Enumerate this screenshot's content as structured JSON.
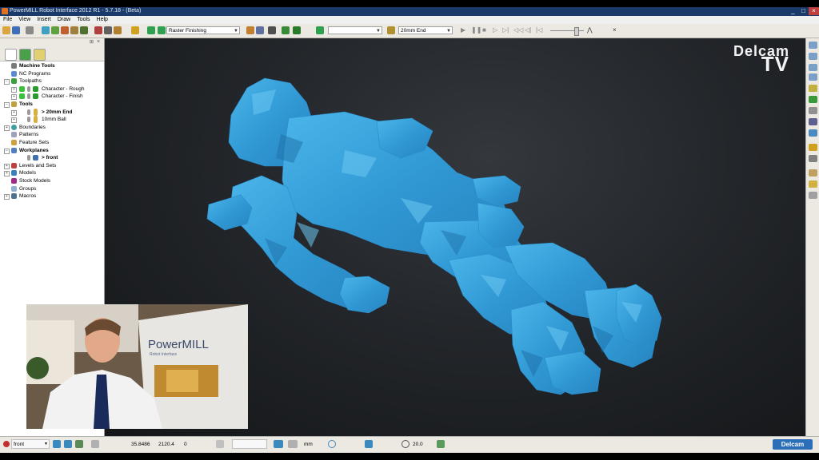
{
  "window": {
    "title": "PowerMILL Robot Interface 2012 R1 - 5.7.18 - (Beta)",
    "minimize": "_",
    "maximize": "□",
    "close": "×"
  },
  "menu": [
    "File",
    "View",
    "Insert",
    "Draw",
    "Tools",
    "Help"
  ],
  "toolbar": {
    "strategy_combo": "Raster Finishing",
    "blank_combo": "",
    "tool_combo": "20mm End"
  },
  "explorer": {
    "items": [
      {
        "label": "Machine Tools",
        "bold": true
      },
      {
        "label": "NC Programs",
        "bold": false
      },
      {
        "label": "Toolpaths",
        "bold": false
      },
      {
        "label": "Character - Rough",
        "bold": false
      },
      {
        "label": "Character - Finish",
        "bold": false
      },
      {
        "label": "Tools",
        "bold": true
      },
      {
        "label": "> 20mm End",
        "bold": true
      },
      {
        "label": "10mm Ball",
        "bold": false
      },
      {
        "label": "Boundaries",
        "bold": false
      },
      {
        "label": "Patterns",
        "bold": false
      },
      {
        "label": "Feature Sets",
        "bold": false
      },
      {
        "label": "Workplanes",
        "bold": true
      },
      {
        "label": "> front",
        "bold": true
      },
      {
        "label": "Levels and Sets",
        "bold": false
      },
      {
        "label": "Models",
        "bold": false
      },
      {
        "label": "Stock Models",
        "bold": false
      },
      {
        "label": "Groups",
        "bold": false
      },
      {
        "label": "Macros",
        "bold": false
      }
    ]
  },
  "watermark": {
    "line1": "Delcam",
    "line2": "TV"
  },
  "webcam": {
    "sign_brand": "PowerMILL",
    "sign_sub": "Robot Interface"
  },
  "status": {
    "view": "front",
    "x": "35.8486",
    "y": "2120.4",
    "z": "0",
    "units": "mm",
    "tolerance": "20.0",
    "brand": "Delcam"
  },
  "colors": {
    "model": "#3aa0d8",
    "viewport_bg": "#1e2125",
    "title_bar": "#1a3a6a"
  }
}
